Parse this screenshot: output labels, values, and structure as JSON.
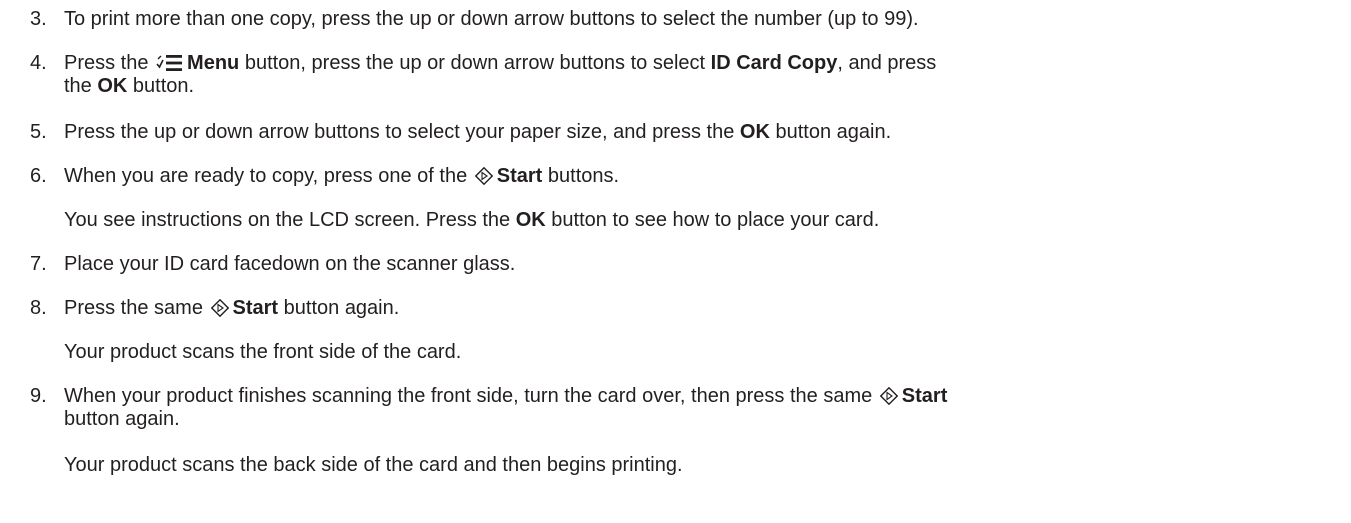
{
  "steps": [
    {
      "number": "3.",
      "lines": [
        "To print more than one copy, press the up or down arrow buttons to select the number (up to 99)."
      ]
    },
    {
      "number": "4.",
      "t1": "Press the ",
      "icon": "menu-icon",
      "b1": "Menu",
      "t2": " button, press the up or down arrow buttons to select ",
      "b2": "ID Card Copy",
      "t3": ", and press",
      "t4": "the ",
      "b3": "OK",
      "t5": " button."
    },
    {
      "number": "5.",
      "t1": "Press the up or down arrow buttons to select your paper size, and press the ",
      "b1": "OK",
      "t2": " button again."
    },
    {
      "number": "6.",
      "t1": "When you are ready to copy, press one of the ",
      "icon": "start-icon",
      "b1": "Start",
      "t2": " buttons.",
      "sub_t1": "You see instructions on the LCD screen. Press the ",
      "sub_b1": "OK",
      "sub_t2": " button to see how to place your card."
    },
    {
      "number": "7.",
      "t1": "Place your ID card facedown on the scanner glass."
    },
    {
      "number": "8.",
      "t1": "Press the same ",
      "icon": "start-icon",
      "b1": "Start",
      "t2": " button again.",
      "sub": "Your product scans the front side of the card."
    },
    {
      "number": "9.",
      "t1": "When your product finishes scanning the front side, turn the card over, then press the same ",
      "icon": "start-icon",
      "b1": "Start",
      "t2": "button again.",
      "sub": "Your product scans the back side of the card and then begins printing."
    }
  ]
}
